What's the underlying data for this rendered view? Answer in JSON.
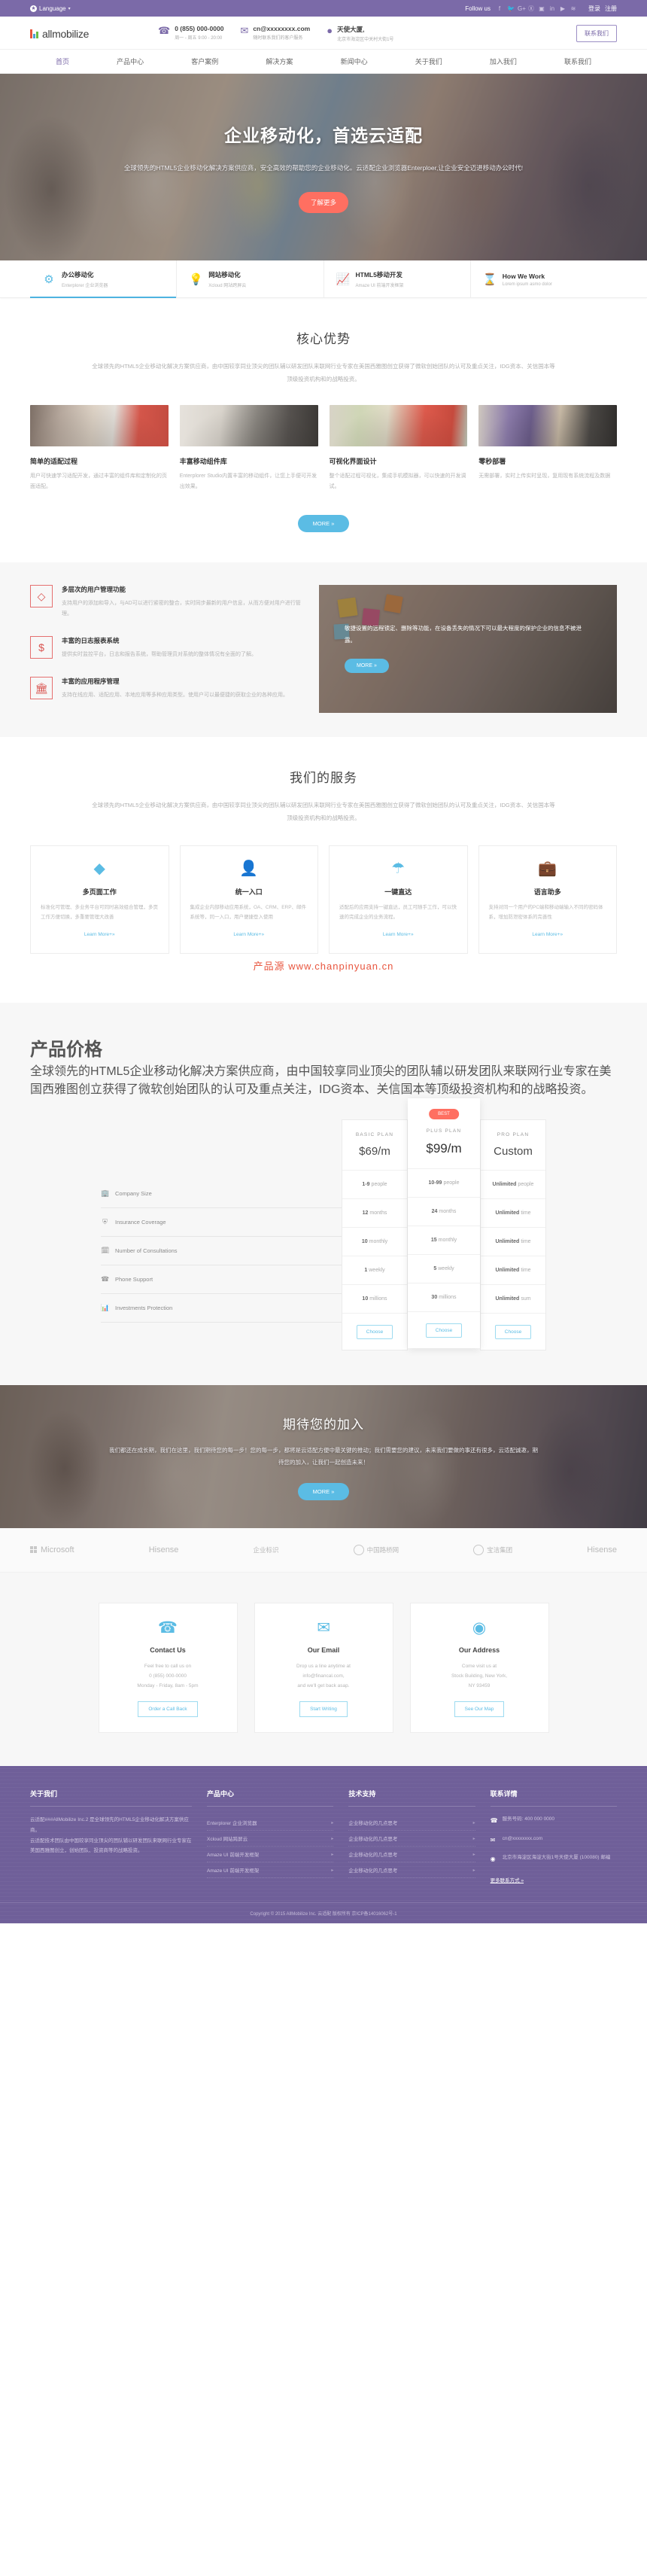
{
  "topbar": {
    "language": "Language",
    "follow_label": "Follow us",
    "social_icons": [
      "facebook-icon",
      "twitter-icon",
      "google-plus-icon",
      "pinterest-icon",
      "instagram-icon",
      "linkedin-icon",
      "youtube-icon",
      "rss-icon"
    ],
    "social_glyphs": [
      "f",
      "ᵛ",
      "G+",
      "ⓟ",
      "▣",
      "in",
      "▶",
      "≋"
    ],
    "login": "登录",
    "register": "注册"
  },
  "header": {
    "brand": "allmobilize",
    "contacts": [
      {
        "icon": "phone-icon",
        "primary": "0 (855) 000-0000",
        "secondary": "周一 - 周五 9:00 - 20:00"
      },
      {
        "icon": "mail-icon",
        "primary": "cn@xxxxxxxx.com",
        "secondary": "随时联系我们的客户服务"
      },
      {
        "icon": "location-icon",
        "primary": "天使大厦,",
        "secondary": "北京市海淀区中关村大街1号"
      }
    ],
    "contact_button": "联系我们"
  },
  "nav": {
    "items": [
      {
        "label": "首页",
        "active": true
      },
      {
        "label": "产品中心",
        "active": false
      },
      {
        "label": "客户案例",
        "active": false
      },
      {
        "label": "解决方案",
        "active": false
      },
      {
        "label": "新闻中心",
        "active": false
      },
      {
        "label": "关于我们",
        "active": false
      },
      {
        "label": "加入我们",
        "active": false
      },
      {
        "label": "联系我们",
        "active": false
      }
    ]
  },
  "hero": {
    "title": "企业移动化，首选云适配",
    "body": "全球领先的HTML5企业移动化解决方案供应商，安全高效的帮助您的企业移动化。云适配企业浏览器Enterploer,让企业安全迈进移动办公时代!",
    "cta": "了解更多"
  },
  "strip": {
    "tabs": [
      {
        "icon": "gear-icon",
        "glyph": "⚙",
        "title": "办公移动化",
        "sub": "Enterplorer 企业浏览器",
        "active": true
      },
      {
        "icon": "bulb-icon",
        "glyph": "Ὂ1",
        "title": "网站移动化",
        "sub": "Xcloud 网站跨屏云",
        "active": false
      },
      {
        "icon": "chart-icon",
        "glyph": "Ὄ8",
        "title": "HTML5移动开发",
        "sub": "Amaze UI 前端开发框架",
        "active": false
      },
      {
        "icon": "hourglass-icon",
        "glyph": "⌛",
        "title": "How We Work",
        "sub": "Lorem ipsum asmo dolor",
        "active": false
      }
    ]
  },
  "core": {
    "title": "核心优势",
    "lede": "全球领先的HTML5企业移动化解决方案供应商，由中国较享同业顶尖的团队辅以研发团队来联网行业专家在美国西雅图创立获得了微软创始团队的认可及重点关注，IDG资本、关信国本等顶级投资机构和的战略投资。",
    "cards": [
      {
        "title": "简单的适配过程",
        "body": "用户可快速学习适配开发，通过丰富的组件库和定制化的页面适配。",
        "image": "team-meeting-photo"
      },
      {
        "title": "丰富移动组件库",
        "body": "Enterplorer Studio内置丰富的移动组件，让您上手便可开发出效果。",
        "image": "developer-desk-photo"
      },
      {
        "title": "可视化界面设计",
        "body": "整个适配过程可视化，集成手机模拟器，可以快速的开发调试。",
        "image": "office-woman-photo"
      },
      {
        "title": "零秒部署",
        "body": "无需部署，实时上传实时呈现，复用现有系统流程及数据",
        "image": "workspace-photo"
      }
    ],
    "more": "MORE  »"
  },
  "features": {
    "items": [
      {
        "icon": "diamond-icon",
        "glyph": "◇",
        "title": "多层次的用户管理功能",
        "body": "支持用户的添加和导入，与AD可以进行紧密的整合，实时同步最新的用户信息，从而方便对用户进行管理。"
      },
      {
        "icon": "dollar-icon",
        "glyph": "$",
        "title": "丰富的日志报表系统",
        "body": "提供实时监控平台，日志和报告系统，帮助管理员对系统的整体情况有全面的了解。"
      },
      {
        "icon": "bank-icon",
        "glyph": "Ἵb",
        "title": "丰富的应用程序管理",
        "body": "支持在线应用、适配应用、本地应用等多种应用类型。使用户可以最便捷的获取企业的各种应用。"
      }
    ],
    "overlay_body": "敏捷设置的远程锁定、删除等功能，在设备丢失的情况下可以最大程度的保护企业的信息不被泄露。",
    "overlay_more": "MORE  »",
    "overlay_image": "sticky-notes-photo"
  },
  "servicesSection": {
    "title": "我们的服务",
    "lede": "全球领先的HTML5企业移动化解决方案供应商，由中国较享同业顶尖的团队辅以研发团队来联网行业专家在美国西雅图创立获得了微软创始团队的认可及重点关注，IDG资本、关信国本等顶级投资机构和的战略投资。",
    "cards": [
      {
        "icon": "diamond-icon",
        "glyph": "◆",
        "title": "多页面工作",
        "body": "标准化可管理、多业务平台可同时高效组合管理，多页工作方便切换，多重要管理大改善",
        "link": "Learn More+»"
      },
      {
        "icon": "user-icon",
        "glyph": "὆4",
        "title": "统一入口",
        "body": "集成企业内部移动应用系统，OA、CRM、ERP、邮件系统等，同一入口，用户便捷登入使用",
        "link": "Learn More+»"
      },
      {
        "icon": "umbrella-icon",
        "glyph": "☂",
        "title": "一键直达",
        "body": "适配后的应用支持一键直达，员工可随手工作，可以快速的完成企业的业务流程。",
        "link": "Learn More+»"
      },
      {
        "icon": "briefcase-icon",
        "glyph": "Ὃc",
        "title": "语言助多",
        "body": "支持对同一个用户的PC端和移动端输入不同的密码体系，增加防泄密体系的完善性",
        "link": "Learn More+»"
      }
    ],
    "watermark_left": "产品源",
    "watermark_right": "www.chanpinyuan.cn"
  },
  "pricing": {
    "title": "产品价格",
    "lede": "全球领先的HTML5企业移动化解决方案供应商，由中国较享同业顶尖的团队辅以研发团队来联网行业专家在美国西雅图创立获得了微软创始团队的认可及重点关注，IDG资本、关信国本等顶级投资机构和的战略投资。",
    "ribbon": "BEST",
    "rows": [
      {
        "icon": "building-icon",
        "glyph": "Ἶ2",
        "label": "Company Size"
      },
      {
        "icon": "shield-icon",
        "glyph": "⛨",
        "label": "Insurance Coverage"
      },
      {
        "icon": "calendar-icon",
        "glyph": "Ὕ3",
        "label": "Number of Consultations"
      },
      {
        "icon": "phone-icon",
        "glyph": "✆",
        "label": "Phone Support"
      },
      {
        "icon": "chart-icon",
        "glyph": "Ὄa",
        "label": "Investments Protection"
      }
    ],
    "plans": [
      {
        "name": "BASIC PLAN",
        "price": "$69/m",
        "featured": false,
        "cells": [
          {
            "value": "1-9",
            "unit": "people"
          },
          {
            "value": "12",
            "unit": "months"
          },
          {
            "value": "10",
            "unit": "monthly"
          },
          {
            "value": "1",
            "unit": "weekly"
          },
          {
            "value": "10",
            "unit": "millions"
          }
        ],
        "button": "Choose"
      },
      {
        "name": "PLUS PLAN",
        "price": "$99/m",
        "featured": true,
        "cells": [
          {
            "value": "10-99",
            "unit": "people"
          },
          {
            "value": "24",
            "unit": "months"
          },
          {
            "value": "15",
            "unit": "monthly"
          },
          {
            "value": "5",
            "unit": "weekly"
          },
          {
            "value": "30",
            "unit": "millions"
          }
        ],
        "button": "Choose"
      },
      {
        "name": "PRO PLAN",
        "price": "Custom",
        "featured": false,
        "cells": [
          {
            "value": "Unlimited",
            "unit": "people"
          },
          {
            "value": "Unlimited",
            "unit": "time"
          },
          {
            "value": "Unlimited",
            "unit": "time"
          },
          {
            "value": "Unlimited",
            "unit": "time"
          },
          {
            "value": "Unlimited",
            "unit": "sum"
          }
        ],
        "button": "Choose"
      }
    ]
  },
  "join": {
    "title": "期待您的加入",
    "body": "我们都还在成长期，我们在这里，我们期待您的每一步！您的每一步，都将是云适配方便中最关键的推动；我们需要您的建议，未来我们要做的事还有很多，云适配诚邀，期待您的加入，让我们一起创造未来！",
    "more": "MORE  »",
    "image": "team-travel-photo"
  },
  "brands": [
    {
      "name": "Microsoft",
      "icon": "microsoft-logo"
    },
    {
      "name": "Hisense",
      "icon": "hisense-logo"
    },
    {
      "name": "企业标识",
      "icon": "calligraphy-logo"
    },
    {
      "name": "中国路桥网",
      "icon": "china-roadbridge-logo"
    },
    {
      "name": "宝洁集团",
      "icon": "seal-logo"
    },
    {
      "name": "Hisense",
      "icon": "hisense-logo-2"
    }
  ],
  "contactCards": [
    {
      "icon": "phone-icon",
      "glyph": "✆",
      "title": "Contact Us",
      "body": "Feel free to call us on\n0 (855) 000-0000\nMonday - Friday, 8am - 5pm",
      "button": "Order a Call Back"
    },
    {
      "icon": "mail-icon",
      "glyph": "✉",
      "title": "Our Email",
      "body": "Drop us a line anytime at\ninfo@financal.com,\nand we'll get back asap.",
      "button": "Start Writing"
    },
    {
      "icon": "location-icon",
      "glyph": "◉",
      "title": "Our Address",
      "body": "Come visit us at\nStock Building, New York,\nNY 93459",
      "button": "See Our Map"
    }
  ],
  "footer": {
    "about": {
      "title": "关于我们",
      "body": "云适配###AllMobilize Inc.2 是全球领先的HTML5企业移动化解决方案供应商。\n云适配技术团队由中国较享同业顶尖的团队辅以研发团队来联网行业专家在美国西雅图创立，创始团队、投资商等的战略投资。"
    },
    "products": {
      "title": "产品中心",
      "items": [
        "Enterplorer 企业浏览器",
        "Xcloud 网站跨屏云",
        "Amaze UI 前端开发框架",
        "Amaze UI 前端开发框架"
      ]
    },
    "support": {
      "title": "技术支持",
      "items": [
        "企业移动化的几点思考",
        "企业移动化的几点思考",
        "企业移动化的几点思考",
        "企业移动化的几点思考"
      ]
    },
    "contact": {
      "title": "联系详情",
      "items": [
        {
          "icon": "phone-icon",
          "glyph": "✆",
          "text": "服务号码: 400 000 0000"
        },
        {
          "icon": "mail-icon",
          "glyph": "✉",
          "text": "cn@xxxxxxxx.com"
        },
        {
          "icon": "location-icon",
          "glyph": "◉",
          "text": "北京市海淀区海淀大街1号天使大厦 (100080) 邮编"
        }
      ],
      "more": "更多联系方式 »"
    },
    "copyright": "Copyright © 2015 AllMobilize Inc. 云适配 版权所有   京ICP备14016062号-1"
  },
  "colors": {
    "purple": "#7b6aa8",
    "footer_purple": "#6f5f99",
    "blue": "#5bbce4",
    "coral": "#ff6f61",
    "red": "#d9534f"
  }
}
